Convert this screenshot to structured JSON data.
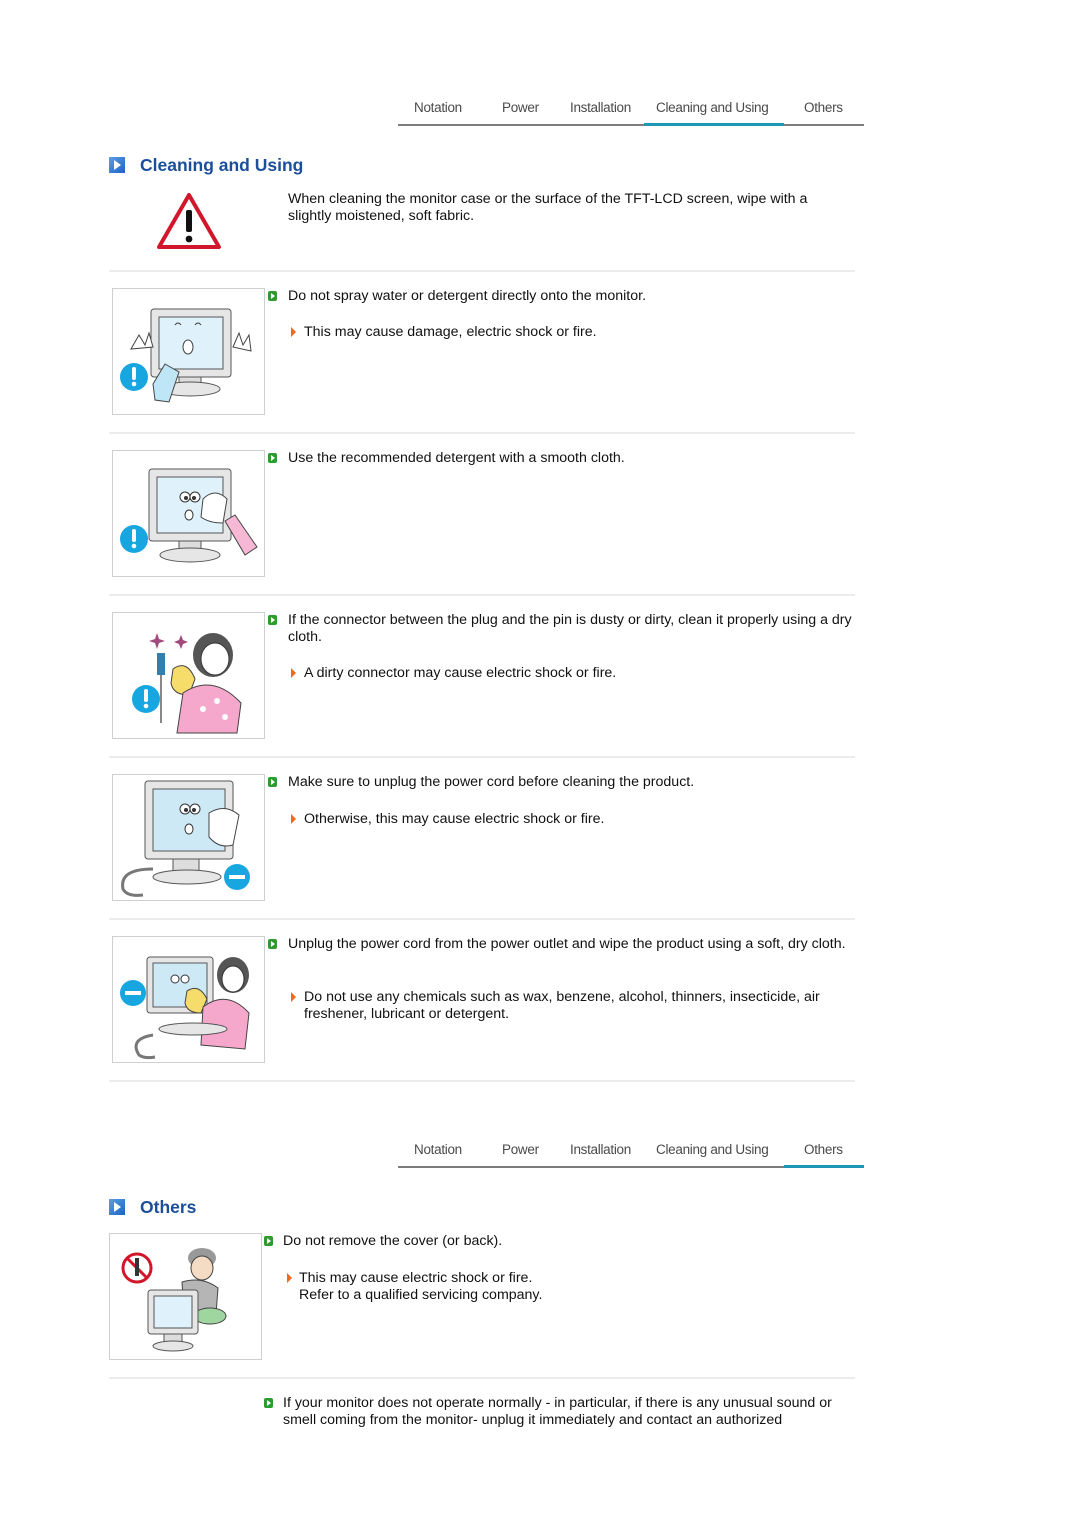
{
  "nav_tabs": [
    "Notation",
    "Power",
    "Installation",
    "Cleaning and Using",
    "Others"
  ],
  "nav_top": {
    "active": "Cleaning and Using"
  },
  "nav_bottom": {
    "active": "Others"
  },
  "cleaning": {
    "title": "Cleaning and Using",
    "intro_icon": "warning-triangle-icon",
    "intro": "When cleaning the monitor case or the surface of the TFT-LCD screen, wipe with a slightly moistened, soft fabric.",
    "items": [
      {
        "text": "Do not spray water or detergent directly onto the monitor.",
        "note": "This may cause damage, electric shock or fire.",
        "image": "spray-monitor-illustration"
      },
      {
        "text": "Use the recommended detergent with a smooth cloth.",
        "note": null,
        "image": "wipe-monitor-illustration"
      },
      {
        "text": "If the connector between the plug and the pin is dusty or dirty, clean it properly using a dry cloth.",
        "note": "A dirty connector may cause electric shock or fire.",
        "image": "clean-connector-illustration"
      },
      {
        "text": "Make sure to unplug the power cord before cleaning the product.",
        "note": "Otherwise, this may cause electric shock or fire.",
        "image": "unplug-before-cleaning-illustration"
      },
      {
        "text": "Unplug the power cord from the power outlet and wipe the product using a soft, dry cloth.",
        "note": "Do not use any chemicals such as wax, benzene, alcohol, thinners, insecticide, air freshener, lubricant or detergent.",
        "image": "unplug-and-wipe-illustration"
      }
    ]
  },
  "others": {
    "title": "Others",
    "items": [
      {
        "text": "Do not remove the cover (or back).",
        "note_lines": [
          "This may cause electric shock or fire.",
          "Refer to a qualified servicing company."
        ],
        "image": "do-not-disassemble-illustration"
      },
      {
        "text": "If your monitor does not operate normally - in particular, if there is any unusual sound or smell coming from the monitor- unplug it immediately and contact an authorized"
      }
    ]
  },
  "colors": {
    "title_blue": "#1b4e9b",
    "tab_underline": "#1e98b4",
    "bullet_green": "#2f9a2f",
    "bullet_orange": "#f06a1a",
    "warning_red": "#d0172b"
  }
}
